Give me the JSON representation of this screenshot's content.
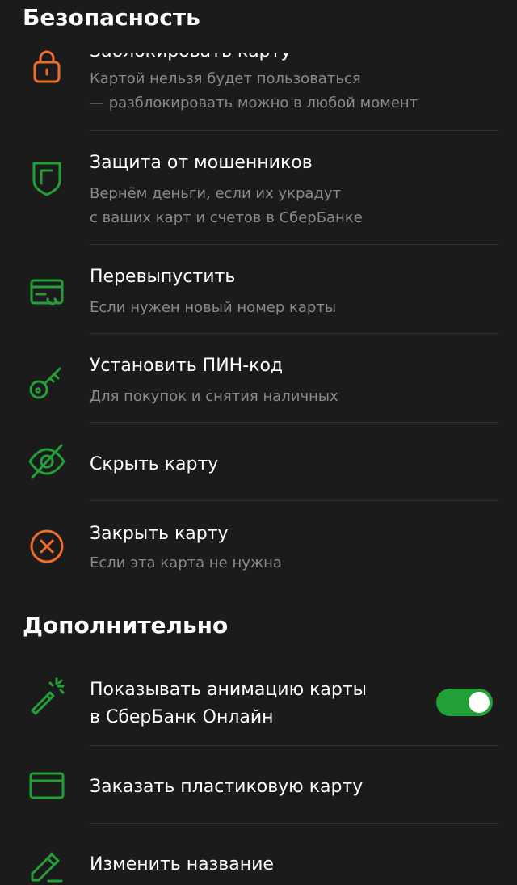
{
  "colors": {
    "background": "#1b1b1b",
    "accent_green": "#21a038",
    "danger_orange": "#ef6c2b",
    "text_primary": "#ffffff",
    "text_secondary": "#8a8a8a"
  },
  "security": {
    "title": "Безопасность",
    "items": [
      {
        "icon": "lock-icon",
        "title": "Заблокировать карту",
        "subtitle_lines": [
          "Картой нельзя будет пользоваться",
          "— разблокировать можно в любой момент"
        ]
      },
      {
        "icon": "shield-icon",
        "title": "Защита от мошенников",
        "subtitle_lines": [
          "Вернём деньги, если их украдут",
          "с ваших карт и счетов в СберБанке"
        ]
      },
      {
        "icon": "card-reissue-icon",
        "title": "Перевыпустить",
        "subtitle_lines": [
          "Если нужен новый номер карты"
        ]
      },
      {
        "icon": "key-icon",
        "title": "Установить ПИН-код",
        "subtitle_lines": [
          "Для покупок и снятия наличных"
        ]
      },
      {
        "icon": "eye-crossed-icon",
        "title": "Скрыть карту",
        "subtitle_lines": []
      },
      {
        "icon": "close-circle-icon",
        "title": "Закрыть карту",
        "subtitle_lines": [
          "Если эта карта не нужна"
        ]
      }
    ]
  },
  "additional": {
    "title": "Дополнительно",
    "items": [
      {
        "icon": "magic-wand-icon",
        "title_lines": [
          "Показывать анимацию карты",
          "в СберБанк Онлайн"
        ],
        "toggle_on": true
      },
      {
        "icon": "card-icon",
        "title_lines": [
          "Заказать пластиковую карту"
        ]
      },
      {
        "icon": "pencil-icon",
        "title_lines": [
          "Изменить название"
        ]
      }
    ]
  }
}
